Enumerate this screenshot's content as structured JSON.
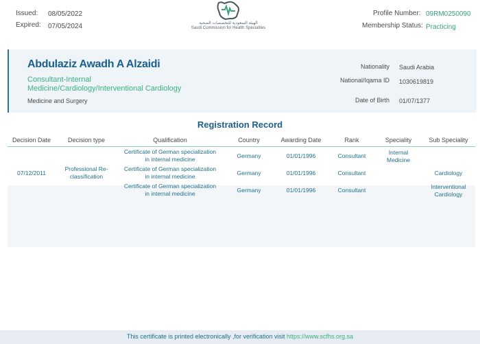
{
  "header": {
    "issued_label": "Issued:",
    "issued_value": "08/05/2022",
    "expired_label": "Expired:",
    "expired_value": "07/05/2024",
    "logo_ar": "الهيئة السعودية للتخصصات الصحية",
    "logo_en": "Saudi Commission for Health Specialties",
    "profile_label": "Profile Number:",
    "profile_value": "09RM0250090",
    "membership_label": "Membership Status:",
    "membership_value": "Practicing"
  },
  "profile": {
    "name": "Abdulaziz Awadh A Alzaidi",
    "title_line1": "Consultant-Internal",
    "title_line2": "Medicine/Cardiology/Interventional Cardiology",
    "category": "Medicine and Surgery",
    "nationality_label": "Nationality",
    "nationality_value": "Saudi Arabia",
    "id_label": "National/Iqama ID",
    "id_value": "1030619819",
    "dob_label": "Date of Birth",
    "dob_value": "01/07/1377"
  },
  "records": {
    "title": "Registration Record",
    "columns": [
      "Decision Date",
      "Decision type",
      "Qualification",
      "Country",
      "Awarding Date",
      "Rank",
      "Speciality",
      "Sub Speciality"
    ],
    "decision_date": "07/12/2011",
    "decision_type_l1": "Professional Re-",
    "decision_type_l2": "classification",
    "rows": [
      {
        "qual_l1": "Certificate of German specialization",
        "qual_l2": "in internal medicine",
        "country": "Germany",
        "awarding": "01/01/1996",
        "rank": "Consultant",
        "spec_l1": "Internal",
        "spec_l2": "Medicine",
        "sub_l1": "",
        "sub_l2": ""
      },
      {
        "qual_l1": "Certificate of German specialization",
        "qual_l2": "in internal medicine",
        "country": "Germany",
        "awarding": "01/01/1996",
        "rank": "Consultant",
        "spec_l1": "",
        "spec_l2": "",
        "sub_l1": "Cardiology",
        "sub_l2": ""
      },
      {
        "qual_l1": "Certificate of German specialization",
        "qual_l2": "in internal medicine",
        "country": "Germany",
        "awarding": "01/01/1996",
        "rank": "Consultant",
        "spec_l1": "",
        "spec_l2": "",
        "sub_l1": "Interventional",
        "sub_l2": "Cardiology"
      }
    ]
  },
  "footer": {
    "text": "This certificate is printed electronically ,for verification visit",
    "link": "https://www.scfhs.org.sa"
  },
  "colors": {
    "accent_blue": "#1b5f8a",
    "accent_green": "#3ab07e"
  }
}
